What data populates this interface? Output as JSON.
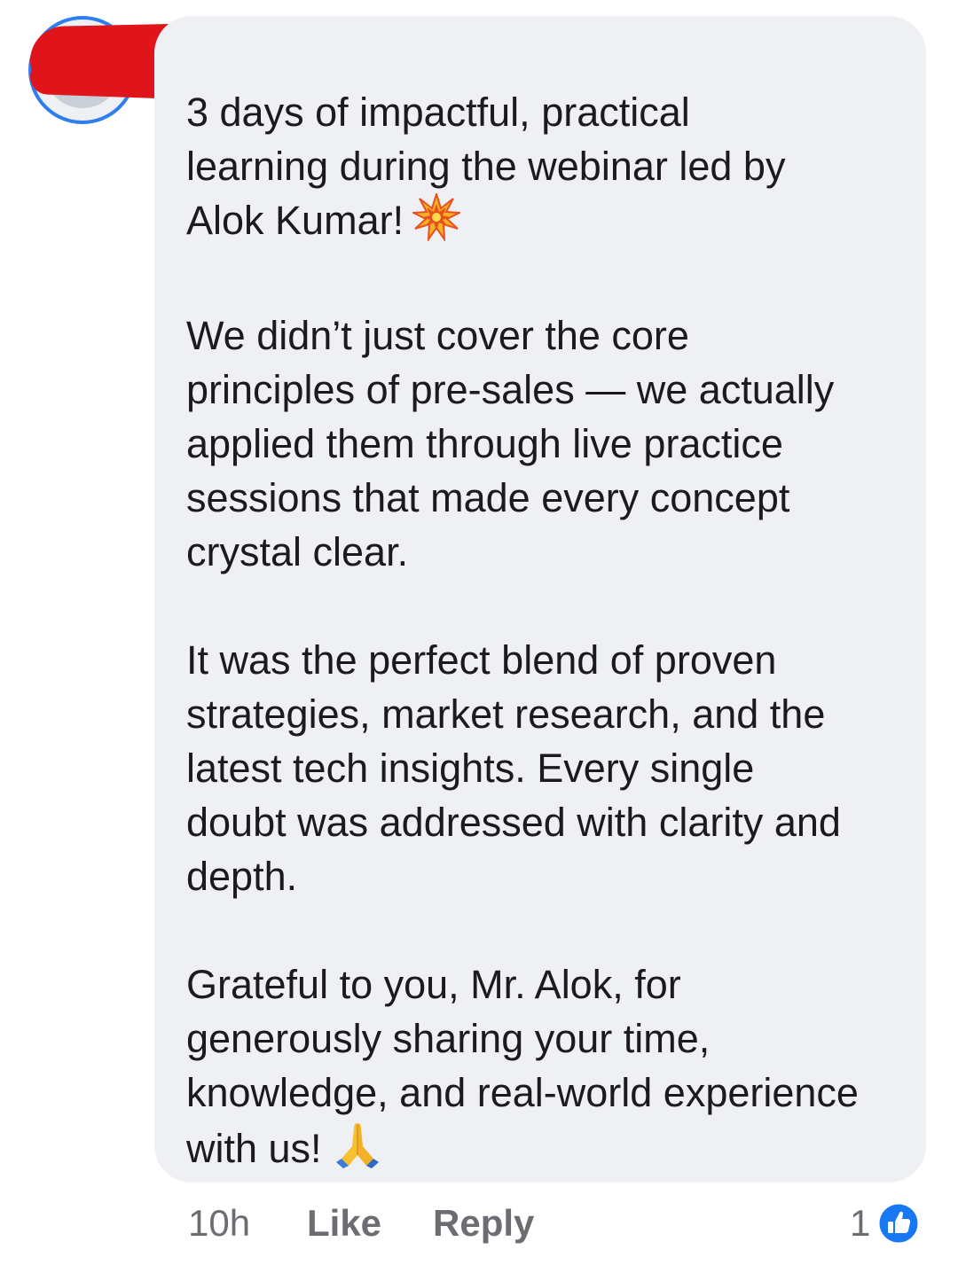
{
  "comment": {
    "author_redacted": true,
    "paragraphs": [
      {
        "lines": [
          "3 days of impactful, practical",
          "learning during the webinar led by",
          "Alok Kumar!"
        ],
        "trailing_emoji": "collision-emoji"
      },
      {
        "lines": [
          "We didn’t just cover the core",
          "principles of pre-sales — we actually",
          "applied them through live practice",
          "sessions that made every concept",
          "crystal clear."
        ]
      },
      {
        "lines": [
          "It was the perfect blend of proven",
          "strategies, market research, and the",
          "latest tech insights. Every single",
          "doubt was addressed with clarity and",
          "depth."
        ]
      },
      {
        "lines": [
          "Grateful to you, Mr. Alok, for",
          "generously sharing your time,",
          "knowledge, and real-world experience",
          "with us!"
        ],
        "trailing_emoji": "folded-hands-emoji"
      }
    ]
  },
  "footer": {
    "time": "10h",
    "like_label": "Like",
    "reply_label": "Reply"
  },
  "reactions": {
    "count": "1",
    "icon": "like-reaction-icon"
  },
  "colors": {
    "bubble": "#eff0f4",
    "text": "#1b1b1d",
    "meta": "#6b6d72",
    "like_blue": "#1877f2",
    "avatar_ring": "#2d7ff0",
    "redaction": "#e0141b"
  }
}
